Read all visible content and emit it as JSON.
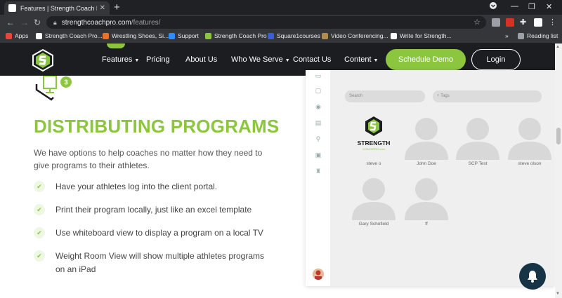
{
  "browser": {
    "tab_title": "Features | Strength Coach Pro - S",
    "url_host": "strengthcoachpro.com",
    "url_path": "/features/",
    "bookmarks": [
      {
        "label": "Apps",
        "color": "#e8453c"
      },
      {
        "label": "Strength Coach Pro...",
        "color": "#ffffff"
      },
      {
        "label": "Wrestling Shoes, Si...",
        "color": "#e8712c"
      },
      {
        "label": "Support",
        "color": "#2d8cff"
      },
      {
        "label": "Strength Coach Pro",
        "color": "#8cc63f"
      },
      {
        "label": "Square1courses",
        "color": "#3b5bdb"
      },
      {
        "label": "Video Conferencing...",
        "color": "#b58b4c"
      },
      {
        "label": "Write for Strength...",
        "color": "#ffffff"
      }
    ],
    "bookmarks_more": "»",
    "reading_list": "Reading list"
  },
  "header": {
    "nav": [
      {
        "label": "Features",
        "caret": true
      },
      {
        "label": "Pricing",
        "caret": false
      },
      {
        "label": "About Us",
        "caret": false
      },
      {
        "label": "Who We Serve",
        "caret": true
      },
      {
        "label": "Contact Us",
        "caret": false
      },
      {
        "label": "Content",
        "caret": true
      }
    ],
    "schedule_demo": "Schedule Demo",
    "login": "Login"
  },
  "content": {
    "step_number": "3",
    "heading": "DISTRIBUTING PROGRAMS",
    "intro": "We have options to help coaches no matter how they need to give programs to their athletes.",
    "features": [
      "Have your athletes log into the client portal.",
      "Print their program locally, just like an excel template",
      "Use whiteboard view to display a program on a local TV",
      "Weight Room View will show multiple athletes programs on an iPad"
    ]
  },
  "mock": {
    "search_placeholder": "Search",
    "tags_placeholder": "+ Tags",
    "logo_text": "STRENGTH",
    "logo_subtext": "COACHPRO.com",
    "athletes": [
      "steve o",
      "John Doe",
      "SCP Test",
      "steve olson",
      "Gary Schofield",
      "ff"
    ]
  },
  "colors": {
    "accent": "#8cc63f",
    "header_bg": "#1c1d21",
    "bell_bg": "#173447"
  }
}
